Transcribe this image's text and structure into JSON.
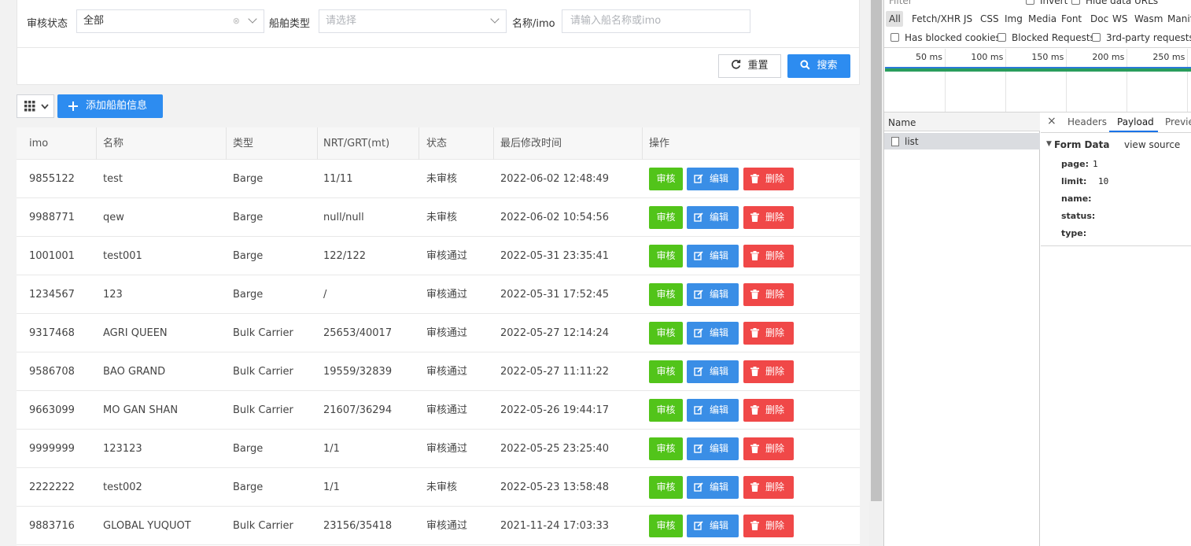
{
  "filters": {
    "status_label": "审核状态",
    "status_value": "全部",
    "clear_glyph": "⊗",
    "type_label": "船舶类型",
    "type_placeholder": "请选择",
    "name_label": "名称/imo",
    "name_placeholder": "请输入船名称或imo",
    "reset_label": "重置",
    "search_label": "搜索"
  },
  "toolbar": {
    "add_label": "添加船舶信息"
  },
  "table": {
    "headers": [
      "imo",
      "名称",
      "类型",
      "NRT/GRT(mt)",
      "状态",
      "最后修改时间",
      "操作"
    ],
    "action_labels": {
      "audit": "审核",
      "edit": "编辑",
      "delete": "删除"
    },
    "rows": [
      {
        "imo": "9855122",
        "name": "test",
        "type": "Barge",
        "nrt_grt": "11/11",
        "status": "未审核",
        "modified": "2022-06-02 12:48:49"
      },
      {
        "imo": "9988771",
        "name": "qew",
        "type": "Barge",
        "nrt_grt": "null/null",
        "status": "未审核",
        "modified": "2022-06-02 10:54:56"
      },
      {
        "imo": "1001001",
        "name": "test001",
        "type": "Barge",
        "nrt_grt": "122/122",
        "status": "审核通过",
        "modified": "2022-05-31 23:35:41"
      },
      {
        "imo": "1234567",
        "name": "123",
        "type": "Barge",
        "nrt_grt": "/",
        "status": "审核通过",
        "modified": "2022-05-31 17:52:45"
      },
      {
        "imo": "9317468",
        "name": "AGRI QUEEN",
        "type": "Bulk Carrier",
        "nrt_grt": "25653/40017",
        "status": "审核通过",
        "modified": "2022-05-27 12:14:24"
      },
      {
        "imo": "9586708",
        "name": "BAO GRAND",
        "type": "Bulk Carrier",
        "nrt_grt": "19559/32839",
        "status": "审核通过",
        "modified": "2022-05-27 11:11:22"
      },
      {
        "imo": "9663099",
        "name": "MO GAN SHAN",
        "type": "Bulk Carrier",
        "nrt_grt": "21607/36294",
        "status": "审核通过",
        "modified": "2022-05-26 19:44:17"
      },
      {
        "imo": "9999999",
        "name": "123123",
        "type": "Barge",
        "nrt_grt": "1/1",
        "status": "审核通过",
        "modified": "2022-05-25 23:25:40"
      },
      {
        "imo": "2222222",
        "name": "test002",
        "type": "Barge",
        "nrt_grt": "1/1",
        "status": "未审核",
        "modified": "2022-05-23 13:58:48"
      },
      {
        "imo": "9883716",
        "name": "GLOBAL YUQUOT",
        "type": "Bulk Carrier",
        "nrt_grt": "23156/35418",
        "status": "审核通过",
        "modified": "2021-11-24 17:03:33"
      }
    ]
  },
  "devtools": {
    "filter_placeholder": "Filter",
    "invert_label": "Invert",
    "hide_data_urls_label": "Hide data URLs",
    "type_filters": [
      "All",
      "Fetch/XHR",
      "JS",
      "CSS",
      "Img",
      "Media",
      "Font",
      "Doc",
      "WS",
      "Wasm",
      "Manif"
    ],
    "has_blocked_cookies_label": "Has blocked cookies",
    "blocked_requests_label": "Blocked Requests",
    "third_party_label": "3rd-party requests",
    "timeline_ticks": [
      "50 ms",
      "100 ms",
      "150 ms",
      "200 ms",
      "250 ms"
    ],
    "name_column": "Name",
    "request_name": "list",
    "close_glyph": "×",
    "tabs": [
      "Headers",
      "Payload",
      "Preview"
    ],
    "form_data_title": "Form Data",
    "view_source_label": "view source",
    "form_fields": [
      {
        "key": "page:",
        "value": "1"
      },
      {
        "key": "limit:",
        "value": "10"
      },
      {
        "key": "name:",
        "value": ""
      },
      {
        "key": "status:",
        "value": ""
      },
      {
        "key": "type:",
        "value": ""
      }
    ],
    "colors": {
      "accent": "#1a73e8",
      "bar_green": "#2a9d5c",
      "bar_blue": "#2b7bd8"
    }
  },
  "colors": {
    "primary": "#2d8cf0",
    "audit": "#52c41a",
    "edit": "#3a8ee6",
    "delete": "#f04848"
  }
}
